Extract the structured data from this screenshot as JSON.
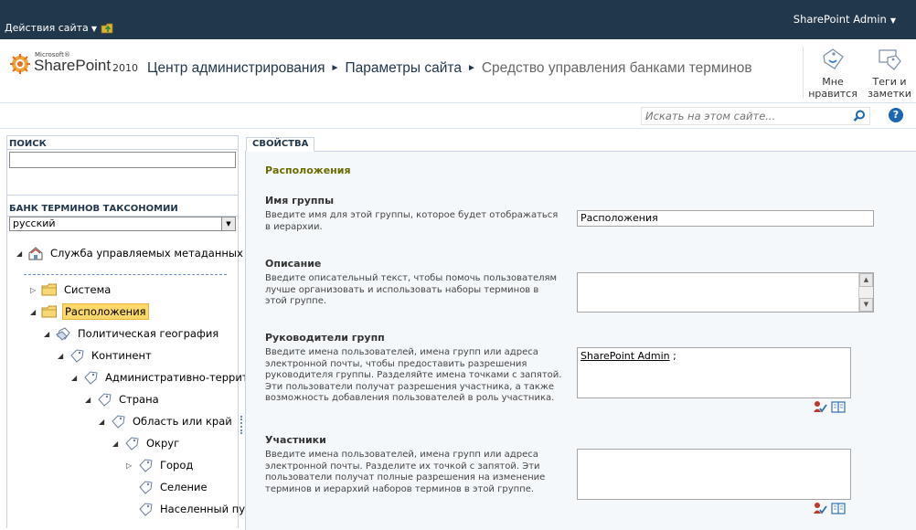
{
  "topbar": {
    "site_actions_label": "Действия сайта",
    "user_label": "SharePoint Admin"
  },
  "logo": {
    "ms_label": "Microsoft®",
    "product_label": "SharePoint",
    "year_label": "2010"
  },
  "breadcrumb": {
    "items": [
      "Центр администрирования",
      "Параметры сайта"
    ],
    "current": "Средство управления банками терминов"
  },
  "ribbon": {
    "like_label_1": "Мне",
    "like_label_2": "нравится",
    "tags_label_1": "Теги и",
    "tags_label_2": "заметки"
  },
  "search": {
    "placeholder": "Искать на этом сайте..."
  },
  "left_pane": {
    "search_header": "ПОИСК",
    "taxonomy_header": "БАНК ТЕРМИНОВ ТАКСОНОМИИ",
    "language_value": "русский",
    "tree": [
      {
        "label": "Служба управляемых метаданных",
        "icon": "metadata-service-icon"
      },
      {
        "label": "Система",
        "icon": "folder-icon"
      },
      {
        "label": "Расположения",
        "icon": "folder-icon"
      },
      {
        "label": "Политическая география",
        "icon": "termset-icon"
      },
      {
        "label": "Континент",
        "icon": "tag-icon"
      },
      {
        "label": "Административно-террит",
        "icon": "tag-icon"
      },
      {
        "label": "Страна",
        "icon": "tag-icon"
      },
      {
        "label": "Область или край",
        "icon": "tag-icon"
      },
      {
        "label": "Округ",
        "icon": "tag-icon"
      },
      {
        "label": "Город",
        "icon": "tag-icon"
      },
      {
        "label": "Селение",
        "icon": "tag-icon"
      },
      {
        "label": "Населенный пу",
        "icon": "tag-icon"
      }
    ]
  },
  "right_pane": {
    "tab_label": "СВОЙСТВА",
    "section_title": "Расположения",
    "group_name": {
      "title": "Имя группы",
      "description": "Введите имя для этой группы, которое будет отображаться в иерархии.",
      "value": "Расположения"
    },
    "description_field": {
      "title": "Описание",
      "description": "Введите описательный текст, чтобы помочь пользователям лучше организовать и использовать наборы терминов в этой группе.",
      "value": ""
    },
    "group_managers": {
      "title": "Руководители групп",
      "description": "Введите имена пользователей, имена групп или адреса электронной почты, чтобы предоставить разрешения руководителя группы. Разделяйте имена точками с запятой. Эти пользователи получат разрешения участника, а также возможность добавления пользователей в роль участника.",
      "value_name": "SharePoint Admin",
      "value_suffix": " ;"
    },
    "contributors": {
      "title": "Участники",
      "description": "Введите имена пользователей, имена групп или адреса электронной почты. Разделите их точкой с запятой. Эти пользователи получат полные разрешения на изменение терминов и иерархий наборов терминов в этой группе.",
      "value": ""
    }
  },
  "colors": {
    "topbar": "#21374c",
    "section_title": "#6b6b00",
    "selected_highlight": "#fbd86a",
    "form_background": "#f5f8fb"
  }
}
